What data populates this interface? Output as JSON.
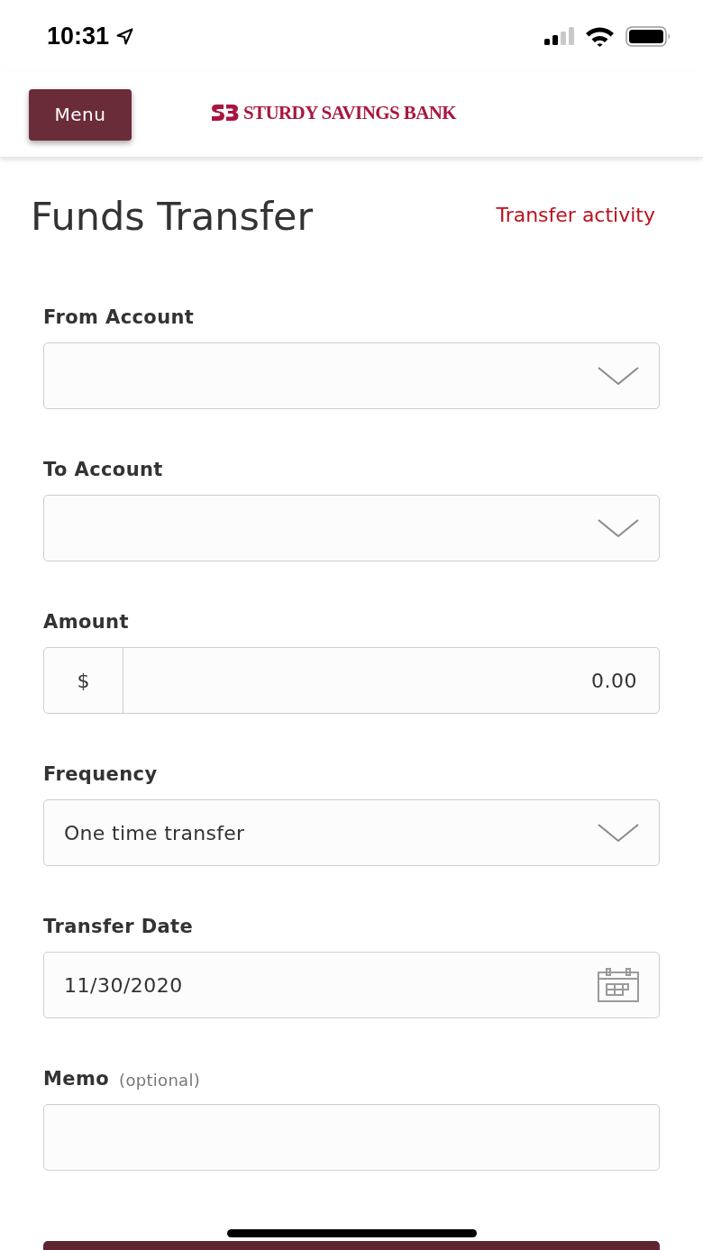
{
  "status_bar": {
    "time": "10:31"
  },
  "header": {
    "menu_button": "Menu",
    "logo_text": "STURDY SAVINGS BANK"
  },
  "page": {
    "title": "Funds Transfer",
    "link": "Transfer activity"
  },
  "fields": [
    {
      "kind": "select",
      "label": "From Account"
    },
    {
      "kind": "select",
      "label": "To Account"
    },
    {
      "kind": "amount",
      "label": "Amount",
      "prefix": "$",
      "value": "0.00"
    },
    {
      "kind": "select",
      "label": "Frequency",
      "value": "One time transfer"
    },
    {
      "kind": "date",
      "label": "Transfer Date",
      "value": "11/30/2020"
    },
    {
      "kind": "text",
      "label": "Memo",
      "hint": "(optional)"
    }
  ]
}
